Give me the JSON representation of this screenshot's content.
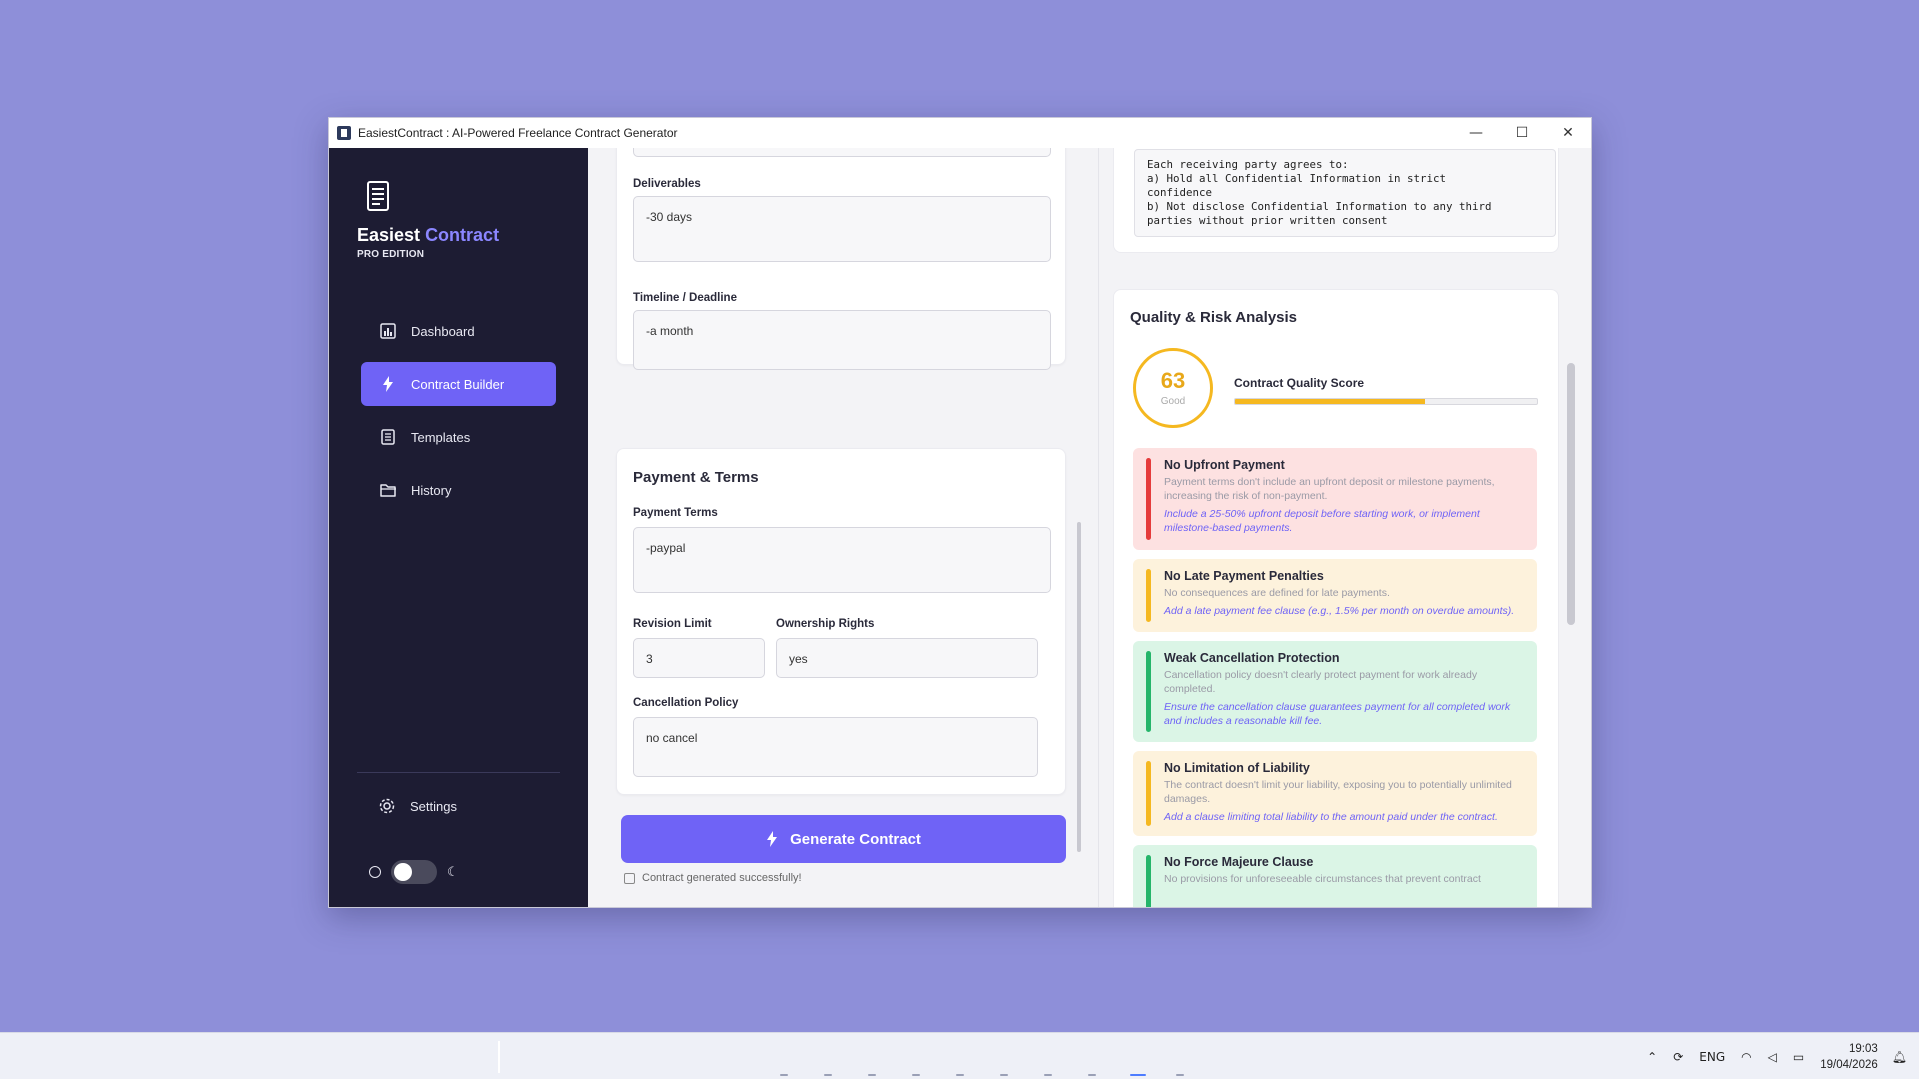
{
  "window": {
    "title": "EasiestContract : AI-Powered Freelance Contract Generator",
    "controls": {
      "minimize": "—",
      "maximize": "☐",
      "close": "✕"
    }
  },
  "sidebar": {
    "brand_first": "Easiest",
    "brand_second": "Contract",
    "edition": "PRO EDITION",
    "nav": [
      {
        "label": "Dashboard",
        "icon": "chart-icon"
      },
      {
        "label": "Contract Builder",
        "icon": "bolt-icon",
        "active": true
      },
      {
        "label": "Templates",
        "icon": "document-icon"
      },
      {
        "label": "History",
        "icon": "folder-icon"
      }
    ],
    "settings_label": "Settings",
    "theme_toggle_dark": false
  },
  "project": {
    "deliverables_label": "Deliverables",
    "deliverables_value": "-30 days",
    "timeline_label": "Timeline / Deadline",
    "timeline_value": "-a month"
  },
  "payment": {
    "title": "Payment & Terms",
    "payment_terms_label": "Payment Terms",
    "payment_terms_value": "-paypal",
    "revision_label": "Revision Limit",
    "revision_value": "3",
    "ownership_label": "Ownership Rights",
    "ownership_value": "yes",
    "cancellation_label": "Cancellation Policy",
    "cancellation_value": "no cancel"
  },
  "actions": {
    "generate_label": "Generate Contract",
    "status": "Contract generated successfully!"
  },
  "preview": {
    "text": "Each receiving party agrees to:\na) Hold all Confidential Information in strict\nconfidence\nb) Not disclose Confidential Information to any third\nparties without prior written consent"
  },
  "analysis": {
    "title": "Quality & Risk Analysis",
    "score": 63,
    "score_label": "Good",
    "score_title": "Contract Quality Score",
    "score_fraction": 0.63,
    "issues": [
      {
        "severity": "red",
        "title": "No Upfront Payment",
        "desc": "Payment terms don't include an upfront deposit or milestone payments, increasing the risk of non-payment.",
        "fix": "Include a 25-50% upfront deposit before starting work, or implement milestone-based payments."
      },
      {
        "severity": "yellow",
        "title": "No Late Payment Penalties",
        "desc": "No consequences are defined for late payments.",
        "fix": "Add a late payment fee clause (e.g., 1.5% per month on overdue amounts)."
      },
      {
        "severity": "green",
        "title": "Weak Cancellation Protection",
        "desc": "Cancellation policy doesn't clearly protect payment for work already completed.",
        "fix": "Ensure the cancellation clause guarantees payment for all completed work and includes a reasonable kill fee."
      },
      {
        "severity": "yellow",
        "title": "No Limitation of Liability",
        "desc": "The contract doesn't limit your liability, exposing you to potentially unlimited damages.",
        "fix": "Add a clause limiting total liability to the amount paid under the contract."
      },
      {
        "severity": "green",
        "title": "No Force Majeure Clause",
        "desc": "No provisions for unforeseeable circumstances that prevent contract",
        "fix": ""
      }
    ]
  },
  "taskbar": {
    "language": "ENG",
    "time": "19:03",
    "date": "19/04/2026"
  },
  "colors": {
    "accent": "#6f63f6",
    "sidebar_bg": "#1d1c33",
    "score": "#f5b820",
    "desktop": "#8e8fd9"
  }
}
